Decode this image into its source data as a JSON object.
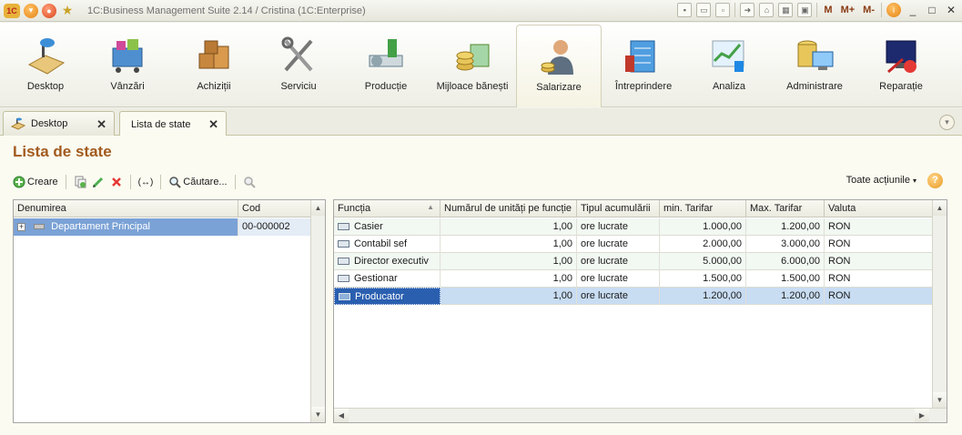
{
  "window": {
    "title": "1C:Business Management Suite 2.14 / Cristina  (1C:Enterprise)",
    "logo_text": "1C",
    "toolbar_m": "M",
    "toolbar_mplus": "M+",
    "toolbar_mminus": "M-"
  },
  "sections": [
    {
      "label": "Desktop",
      "icon": "desktop-icon"
    },
    {
      "label": "Vânzări",
      "icon": "sales-icon"
    },
    {
      "label": "Achiziții",
      "icon": "purchases-icon"
    },
    {
      "label": "Serviciu",
      "icon": "service-icon"
    },
    {
      "label": "Producție",
      "icon": "production-icon"
    },
    {
      "label": "Mijloace bănești",
      "icon": "money-icon"
    },
    {
      "label": "Salarizare",
      "icon": "payroll-icon"
    },
    {
      "label": "Întreprindere",
      "icon": "enterprise-icon"
    },
    {
      "label": "Analiza",
      "icon": "analysis-icon"
    },
    {
      "label": "Administrare",
      "icon": "administration-icon"
    },
    {
      "label": "Reparație",
      "icon": "repair-icon"
    }
  ],
  "tabs": [
    {
      "label": "Desktop"
    },
    {
      "label": "Lista de state"
    }
  ],
  "page": {
    "title": "Lista de state"
  },
  "toolbar": {
    "create_label": "Creare",
    "search_label": "Căutare...",
    "all_actions_label": "Toate acțiunile",
    "help_label": "?"
  },
  "left_table": {
    "columns": [
      "Denumirea",
      "Cod"
    ],
    "rows": [
      {
        "name": "Departament Principal",
        "code": "00-000002"
      }
    ]
  },
  "right_table": {
    "columns": [
      "Funcția",
      "Numărul de unități pe funcție",
      "Tipul acumulării",
      "min. Tarifar",
      "Max. Tarifar",
      "Valuta"
    ],
    "rows": [
      {
        "func": "Casier",
        "units": "1,00",
        "type": "ore lucrate",
        "min": "1.000,00",
        "max": "1.200,00",
        "cur": "RON"
      },
      {
        "func": "Contabil sef",
        "units": "1,00",
        "type": "ore lucrate",
        "min": "2.000,00",
        "max": "3.000,00",
        "cur": "RON"
      },
      {
        "func": "Director executiv",
        "units": "1,00",
        "type": "ore lucrate",
        "min": "5.000,00",
        "max": "6.000,00",
        "cur": "RON"
      },
      {
        "func": "Gestionar",
        "units": "1,00",
        "type": "ore lucrate",
        "min": "1.500,00",
        "max": "1.500,00",
        "cur": "RON"
      },
      {
        "func": "Producator",
        "units": "1,00",
        "type": "ore lucrate",
        "min": "1.200,00",
        "max": "1.200,00",
        "cur": "RON"
      }
    ],
    "selected_row": 4
  }
}
